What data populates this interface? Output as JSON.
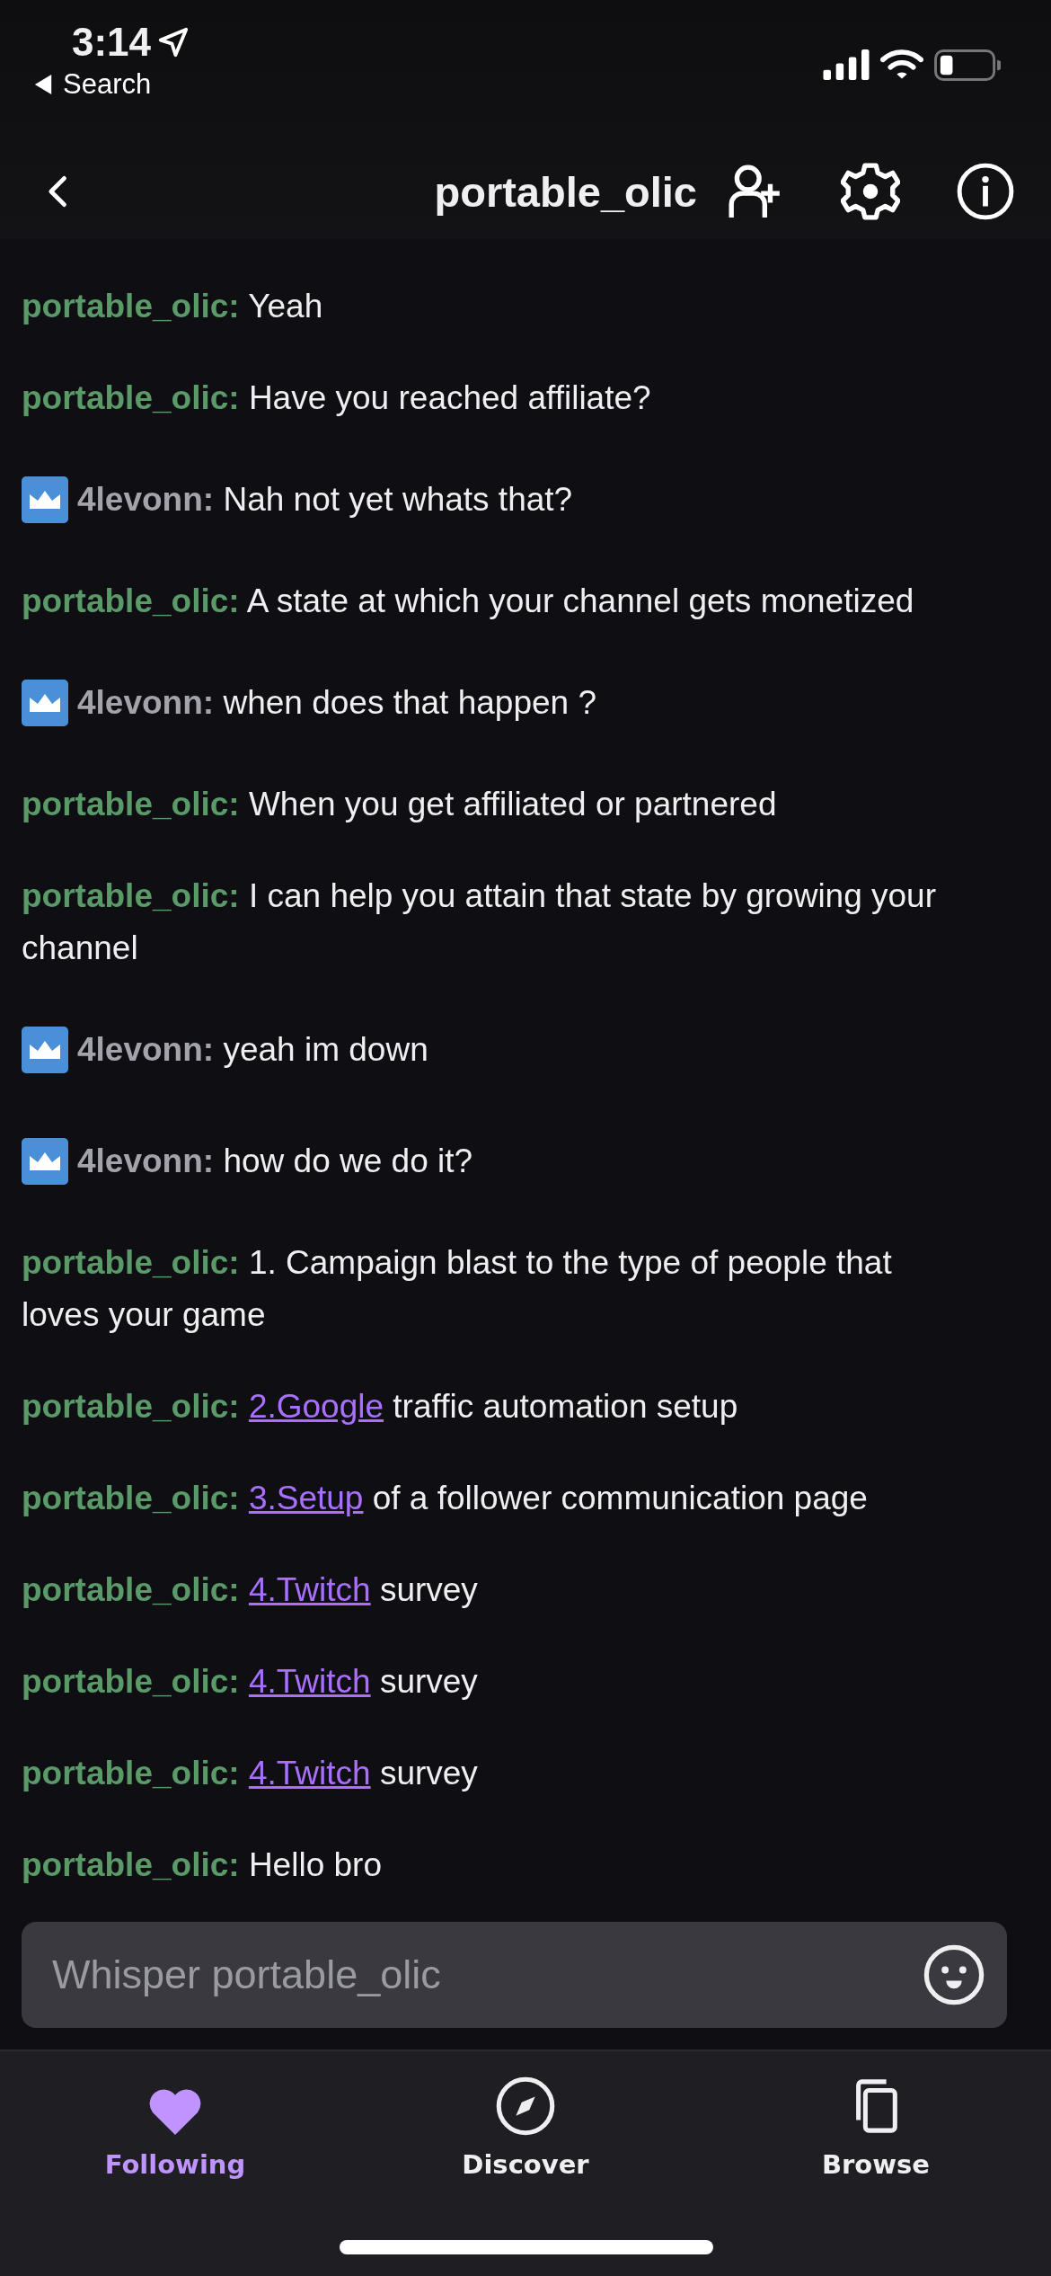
{
  "status_bar": {
    "time": "3:14",
    "back_label": "Search"
  },
  "header": {
    "title": "portable_olic"
  },
  "messages": [
    {
      "user": "portable_olic:",
      "badge": false,
      "text": "Yeah"
    },
    {
      "user": "portable_olic:",
      "badge": false,
      "text": "Have you reached affiliate?"
    },
    {
      "user": "4levonn:",
      "badge": true,
      "text": "Nah not yet whats that?"
    },
    {
      "user": "portable_olic:",
      "badge": false,
      "text": "A state at which your channel gets monetized"
    },
    {
      "user": "4levonn:",
      "badge": true,
      "text": "when does that happen ?"
    },
    {
      "user": "portable_olic:",
      "badge": false,
      "text": "When you get affiliated or partnered"
    },
    {
      "user": "portable_olic:",
      "badge": false,
      "text": "I can help you attain that state by growing your channel"
    },
    {
      "user": "4levonn:",
      "badge": true,
      "text": "yeah im down"
    },
    {
      "user": "4levonn:",
      "badge": true,
      "text": "how do we do it?"
    },
    {
      "user": "portable_olic:",
      "badge": false,
      "text": "1. Campaign blast to the type of people that loves your game"
    },
    {
      "user": "portable_olic:",
      "badge": false,
      "link": "2.Google",
      "text": "traffic automation setup"
    },
    {
      "user": "portable_olic:",
      "badge": false,
      "link": "3.Setup",
      "text": "of a follower communication page"
    },
    {
      "user": "portable_olic:",
      "badge": false,
      "link": "4.Twitch",
      "text": "survey"
    },
    {
      "user": "portable_olic:",
      "badge": false,
      "link": "4.Twitch",
      "text": "survey"
    },
    {
      "user": "portable_olic:",
      "badge": false,
      "link": "4.Twitch",
      "text": "survey"
    },
    {
      "user": "portable_olic:",
      "badge": false,
      "text": "Hello bro"
    }
  ],
  "composer": {
    "placeholder": "Whisper portable_olic"
  },
  "tabs": [
    {
      "label": "Following",
      "kind": "heart",
      "selected": true
    },
    {
      "label": "Discover",
      "kind": "compass",
      "selected": false
    },
    {
      "label": "Browse",
      "kind": "copy",
      "selected": false
    }
  ]
}
